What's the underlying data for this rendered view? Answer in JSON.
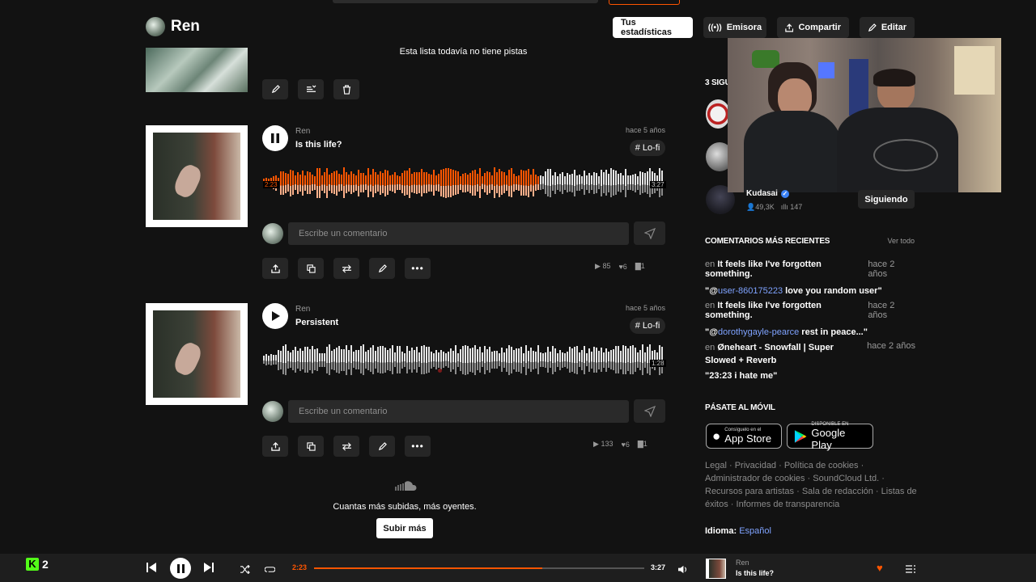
{
  "header": {
    "artist": "Ren",
    "stats_button": "Tus estadísticas",
    "station_button": "Emisora",
    "share_button": "Compartir",
    "edit_button": "Editar"
  },
  "playlist": {
    "empty_text": "Esta lista todavía no tiene pistas"
  },
  "tracks": [
    {
      "artist": "Ren",
      "title": "Is this life?",
      "age": "hace 5 años",
      "tag": "# Lo-fi",
      "elapsed": "2:23",
      "duration": "3:27",
      "progress": 0.69,
      "comment_placeholder": "Escribe un comentario",
      "plays": "85",
      "likes": "6",
      "comments": "1"
    },
    {
      "artist": "Ren",
      "title": "Persistent",
      "age": "hace 5 años",
      "tag": "# Lo-fi",
      "duration": "1:28",
      "comment_placeholder": "Escribe un comentario",
      "plays": "133",
      "likes": "6",
      "comments": "1"
    }
  ],
  "upload_prompt": {
    "text": "Cuantas más subidas, más oyentes.",
    "button": "Subir más"
  },
  "sidebar": {
    "following_title": "3 SIGU",
    "follow_item": {
      "name": "Kudasai",
      "followers": "49,3K",
      "tracks": "147",
      "button": "Siguiendo"
    },
    "recent_title": "COMENTARIOS MÁS RECIENTES",
    "view_all": "Ver todo",
    "comments": [
      {
        "prefix": "en",
        "track": "It feels like I've forgotten something.",
        "time": "hace 2 años",
        "open": "\"@",
        "user": "user-860175223",
        "rest": " love you random user\""
      },
      {
        "prefix": "en",
        "track": "It feels like I've forgotten something.",
        "time": "hace 2 años",
        "open": "\"@",
        "user": "dorothygayle-pearce",
        "rest": " rest in peace...\""
      },
      {
        "prefix": "en",
        "track": "Øneheart - Snowfall | Super Slowed + Reverb",
        "time": "hace 2 años",
        "text": "\"23:23 i hate me\""
      }
    ],
    "mobile_title": "PÁSATE AL MÓVIL",
    "app_store": {
      "small": "Consíguelo en el",
      "big": "App Store"
    },
    "google_play": {
      "small": "DISPONIBLE EN",
      "big": "Google Play"
    },
    "footer_links": "Legal · Privacidad · Política de cookies · Administrador de cookies · SoundCloud Ltd. · Recursos para artistas · Sala de redacción · Listas de éxitos · Informes de transparencia",
    "language_label": "Idioma:",
    "language_value": "Español"
  },
  "player": {
    "logo": "2",
    "elapsed": "2:23",
    "duration": "3:27",
    "progress": 0.69,
    "artist": "Ren",
    "title": "Is this life?"
  },
  "colors": {
    "accent": "#ff5500",
    "background": "#121212",
    "bar": "#1e1e1e"
  }
}
